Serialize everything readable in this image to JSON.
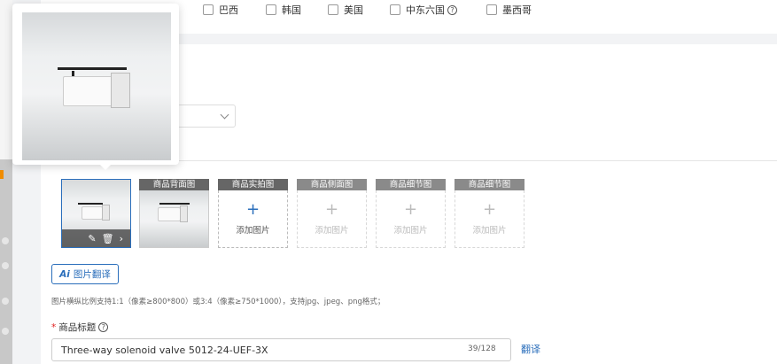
{
  "countries": [
    {
      "label": "巴西",
      "checked": false
    },
    {
      "label": "韩国",
      "checked": false
    },
    {
      "label": "美国",
      "checked": false
    },
    {
      "label": "中东六国",
      "checked": false,
      "has_help": true
    },
    {
      "label": "墨西哥",
      "checked": false
    }
  ],
  "image_slots": {
    "main": {
      "actions": [
        "edit-icon",
        "delete-icon",
        "chevron-right-icon"
      ]
    },
    "back": {
      "label": "商品背面图"
    },
    "real_photo": {
      "label": "商品实拍图",
      "add_label": "添加图片"
    },
    "side": {
      "label": "商品侧面图",
      "add_label": "添加图片"
    },
    "detail_1": {
      "label": "商品细节图",
      "add_label": "添加图片"
    },
    "detail_2": {
      "label": "商品细节图",
      "add_label": "添加图片"
    }
  },
  "ai_translate": {
    "label": "图片翻译",
    "icon_text": "Ai"
  },
  "image_hint": "图片横纵比例支持1:1（像素≥800*800）或3:4（像素≥750*1000），支持jpg、jpeg、png格式；",
  "product_title": {
    "required_mark": "*",
    "label": "商品标题",
    "value": "Three-way solenoid valve 5012-24-UEF-3X",
    "count": "39/128",
    "translate_label": "翻译"
  },
  "help_glyph": "?",
  "colors": {
    "accent": "#2a6ebb",
    "required": "#e02020",
    "rail_highlight": "#f08c00"
  }
}
